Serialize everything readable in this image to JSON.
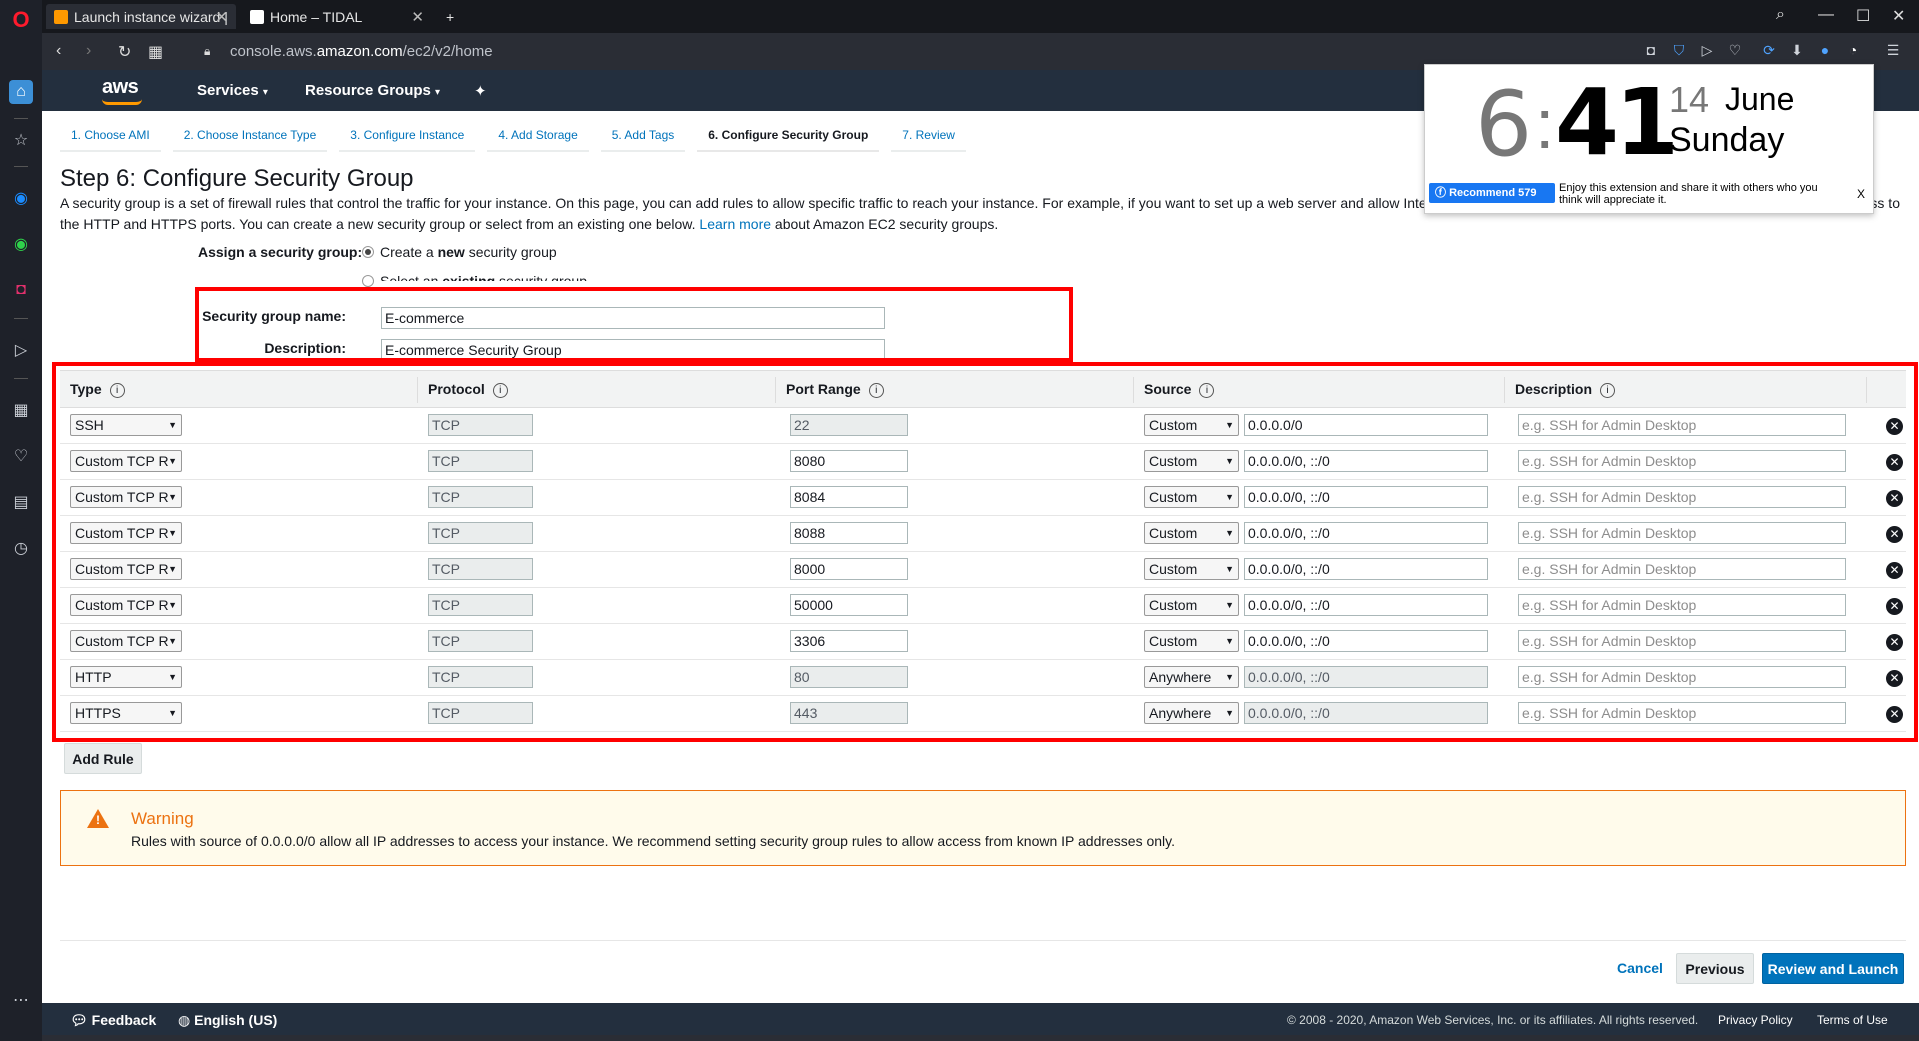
{
  "browser": {
    "tabs": [
      {
        "title": "Launch instance wizard |"
      },
      {
        "title": "Home – TIDAL"
      }
    ],
    "new_tab": "+",
    "url_prefix": "console.aws.",
    "url_host": "amazon.com",
    "url_path": "/ec2/v2/home"
  },
  "aws": {
    "logo": "aws",
    "services": "Services",
    "resource_groups": "Resource Groups"
  },
  "wizard": {
    "steps": [
      "1. Choose AMI",
      "2. Choose Instance Type",
      "3. Configure Instance",
      "4. Add Storage",
      "5. Add Tags",
      "6. Configure Security Group",
      "7. Review"
    ]
  },
  "page": {
    "title": "Step 6: Configure Security Group",
    "intro_1": "A security group is a set of firewall rules that control the traffic for your instance. On this page, you can add rules to allow specific traffic to reach your instance. For example, if you want to set up a web server and allow Inte",
    "intro_1_end": "ss to",
    "intro_2": "the HTTP and HTTPS ports. You can create a new security group or select from an existing one below.",
    "learn_more": "Learn more",
    "intro_3": "about Amazon EC2 security groups.",
    "assign_label": "Assign a security group:",
    "radio_new_a": "Create a ",
    "radio_new_b": "new",
    "radio_new_c": " security group",
    "radio_existing_a": "Select an ",
    "radio_existing_b": "existing",
    "radio_existing_c": " security group",
    "sg_name_label": "Security group name:",
    "sg_name_value": "E-commerce",
    "sg_desc_label": "Description:",
    "sg_desc_value": "E-commerce Security Group"
  },
  "table": {
    "headers": [
      "Type",
      "Protocol",
      "Port Range",
      "Source",
      "Description"
    ],
    "info_glyph": "i",
    "rows": [
      {
        "type": "SSH",
        "protocol": "TCP",
        "port": "22",
        "port_editable": false,
        "source": "Custom",
        "cidr": "0.0.0.0/0",
        "cidr_editable": true,
        "desc_placeholder": "e.g. SSH for Admin Desktop"
      },
      {
        "type": "Custom TCP R",
        "protocol": "TCP",
        "port": "8080",
        "port_editable": true,
        "source": "Custom",
        "cidr": "0.0.0.0/0, ::/0",
        "cidr_editable": true,
        "desc_placeholder": "e.g. SSH for Admin Desktop"
      },
      {
        "type": "Custom TCP R",
        "protocol": "TCP",
        "port": "8084",
        "port_editable": true,
        "source": "Custom",
        "cidr": "0.0.0.0/0, ::/0",
        "cidr_editable": true,
        "desc_placeholder": "e.g. SSH for Admin Desktop"
      },
      {
        "type": "Custom TCP R",
        "protocol": "TCP",
        "port": "8088",
        "port_editable": true,
        "source": "Custom",
        "cidr": "0.0.0.0/0, ::/0",
        "cidr_editable": true,
        "desc_placeholder": "e.g. SSH for Admin Desktop"
      },
      {
        "type": "Custom TCP R",
        "protocol": "TCP",
        "port": "8000",
        "port_editable": true,
        "source": "Custom",
        "cidr": "0.0.0.0/0, ::/0",
        "cidr_editable": true,
        "desc_placeholder": "e.g. SSH for Admin Desktop"
      },
      {
        "type": "Custom TCP R",
        "protocol": "TCP",
        "port": "50000",
        "port_editable": true,
        "source": "Custom",
        "cidr": "0.0.0.0/0, ::/0",
        "cidr_editable": true,
        "desc_placeholder": "e.g. SSH for Admin Desktop"
      },
      {
        "type": "Custom TCP R",
        "protocol": "TCP",
        "port": "3306",
        "port_editable": true,
        "source": "Custom",
        "cidr": "0.0.0.0/0, ::/0",
        "cidr_editable": true,
        "desc_placeholder": "e.g. SSH for Admin Desktop"
      },
      {
        "type": "HTTP",
        "protocol": "TCP",
        "port": "80",
        "port_editable": false,
        "source": "Anywhere",
        "cidr": "0.0.0.0/0, ::/0",
        "cidr_editable": false,
        "desc_placeholder": "e.g. SSH for Admin Desktop"
      },
      {
        "type": "HTTPS",
        "protocol": "TCP",
        "port": "443",
        "port_editable": false,
        "source": "Anywhere",
        "cidr": "0.0.0.0/0, ::/0",
        "cidr_editable": false,
        "desc_placeholder": "e.g. SSH for Admin Desktop"
      }
    ],
    "remove_glyph": "✕",
    "add_rule": "Add Rule"
  },
  "warning": {
    "title": "Warning",
    "text": "Rules with source of 0.0.0.0/0 allow all IP addresses to access your instance. We recommend setting security group rules to allow access from known IP addresses only."
  },
  "actions": {
    "cancel": "Cancel",
    "previous": "Previous",
    "review": "Review and Launch"
  },
  "footer": {
    "feedback": "Feedback",
    "language": "English (US)",
    "copyright": "© 2008 - 2020, Amazon Web Services, Inc. or its affiliates. All rights reserved.",
    "privacy": "Privacy Policy",
    "terms": "Terms of Use"
  },
  "clock": {
    "hour": "6",
    "colon": ":",
    "minute": "41",
    "day": "14",
    "month": "June",
    "weekday": "Sunday",
    "recommend": "Recommend 579",
    "promo": "Enjoy this extension and share it with others who you think will appreciate it.",
    "close": "X"
  },
  "colors": {
    "aws_dark": "#232f3e",
    "aws_orange": "#ff9900",
    "link_blue": "#0073bb",
    "highlight_red": "#ff0000",
    "warning_orange": "#ec7211"
  }
}
